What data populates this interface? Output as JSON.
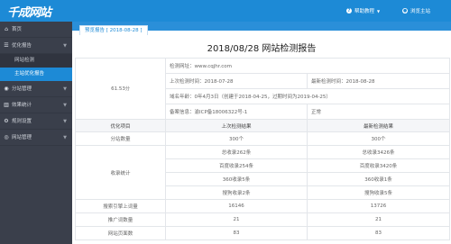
{
  "header": {
    "logo_text": "千成网站",
    "help_label": "帮助教程",
    "site_label": "浏览主站",
    "bg_color": "#1d8ad6"
  },
  "sidebar": {
    "items": [
      {
        "label": "首页",
        "icon": "home-icon"
      },
      {
        "label": "优化报告",
        "icon": "list-icon",
        "expanded": true,
        "children": [
          {
            "label": "网站检测",
            "active": false
          },
          {
            "label": "主站优化报告",
            "active": true
          }
        ]
      },
      {
        "label": "分站管理",
        "icon": "location-icon"
      },
      {
        "label": "效果统计",
        "icon": "chart-icon"
      },
      {
        "label": "规则设置",
        "icon": "gear-icon"
      },
      {
        "label": "网站管理",
        "icon": "globe-icon"
      }
    ]
  },
  "main": {
    "tab_label": "预览报告 [ 2018-08-28 ]",
    "report_title": "2018/08/28 网站检测报告",
    "score": "61.53",
    "score_unit": "分",
    "info": {
      "site_url": "检测网址：www.cqjhr.com",
      "last_check": "上次检测时间：2018-07-28",
      "latest_check": "最新检测时间：2018-08-28",
      "domain_age": "域名年龄：0年4月3日（创建于2018-04-25，过期时间为2019-04-25）",
      "icp": "备案信息：渝ICP备18006322号-1",
      "icp_status": "正常"
    },
    "table": {
      "headers": [
        "优化项目",
        "上次检测结果",
        "最新检测结果"
      ],
      "rows": [
        {
          "label": "分站数量",
          "values": [
            [
              "300个",
              "300个"
            ]
          ]
        },
        {
          "label": "收录统计",
          "values": [
            [
              "总收录262条",
              "总收录3426条"
            ],
            [
              "百度收录254条",
              "百度收录3420条"
            ],
            [
              "360收录5条",
              "360收录1条"
            ],
            [
              "搜狗收录2条",
              "搜狗收录5条"
            ]
          ]
        },
        {
          "label": "搜索引擎上词量",
          "values": [
            [
              "16146",
              "13726"
            ]
          ]
        },
        {
          "label": "推广词数量",
          "values": [
            [
              "21",
              "21"
            ]
          ]
        },
        {
          "label": "网站页面数",
          "values": [
            [
              "83",
              "83"
            ]
          ]
        }
      ]
    }
  }
}
